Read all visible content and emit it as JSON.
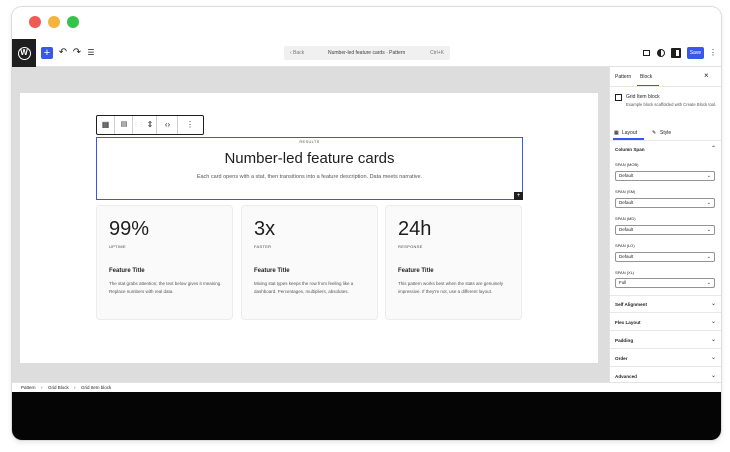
{
  "topbar": {
    "wp_logo": "W",
    "add_icon": "+",
    "undo_icon": "↶",
    "redo_icon": "↷",
    "list_icon": "☰",
    "command": {
      "back": "‹ Back",
      "title": "Number-led feature cards · Pattern",
      "shortcut": "Ctrl+K"
    },
    "save_label": "Save"
  },
  "canvas": {
    "block_toolbar": {
      "parent_icon": "▦",
      "drag": "⋮⋮",
      "move": "⇕",
      "layout_icon": "▤",
      "code_icon": "‹›",
      "more": "⋮"
    },
    "hero": {
      "label": "RESULTS",
      "title": "Number-led feature cards",
      "subtitle": "Each card opens with a stat, then transitions into a feature description. Data meets narrative."
    },
    "cards": [
      {
        "stat": "99%",
        "label": "UPTIME",
        "title": "Feature Title",
        "body": "The stat grabs attention; the text below gives it meaning. Replace numbers with real data."
      },
      {
        "stat": "3x",
        "label": "FASTER",
        "title": "Feature Title",
        "body": "Mixing stat types keeps the row from feeling like a dashboard. Percentages, multipliers, absolutes."
      },
      {
        "stat": "24h",
        "label": "RESPONSE",
        "title": "Feature Title",
        "body": "This pattern works best when the stats are genuinely impressive. If they're not, use a different layout."
      }
    ]
  },
  "sidebar": {
    "tabs": [
      "Pattern",
      "Block"
    ],
    "close": "×",
    "block": {
      "name": "Grid Item block",
      "description": "Example block scaffolded with Create Block tool."
    },
    "subtabs": [
      "Layout",
      "Style"
    ],
    "column_span": {
      "title": "Column Span",
      "fields": [
        {
          "label": "SPAN (MOB)",
          "value": "Default"
        },
        {
          "label": "SPAN (SM)",
          "value": "Default"
        },
        {
          "label": "SPAN (MD)",
          "value": "Default"
        },
        {
          "label": "SPAN (LG)",
          "value": "Default"
        },
        {
          "label": "SPAN (XL)",
          "value": "Full"
        }
      ]
    },
    "sections": [
      "Self Alignment",
      "Flex Layout",
      "Padding",
      "Order",
      "Advanced"
    ]
  },
  "breadcrumb": [
    "Pattern",
    "Grid Block",
    "Grid Item block"
  ]
}
